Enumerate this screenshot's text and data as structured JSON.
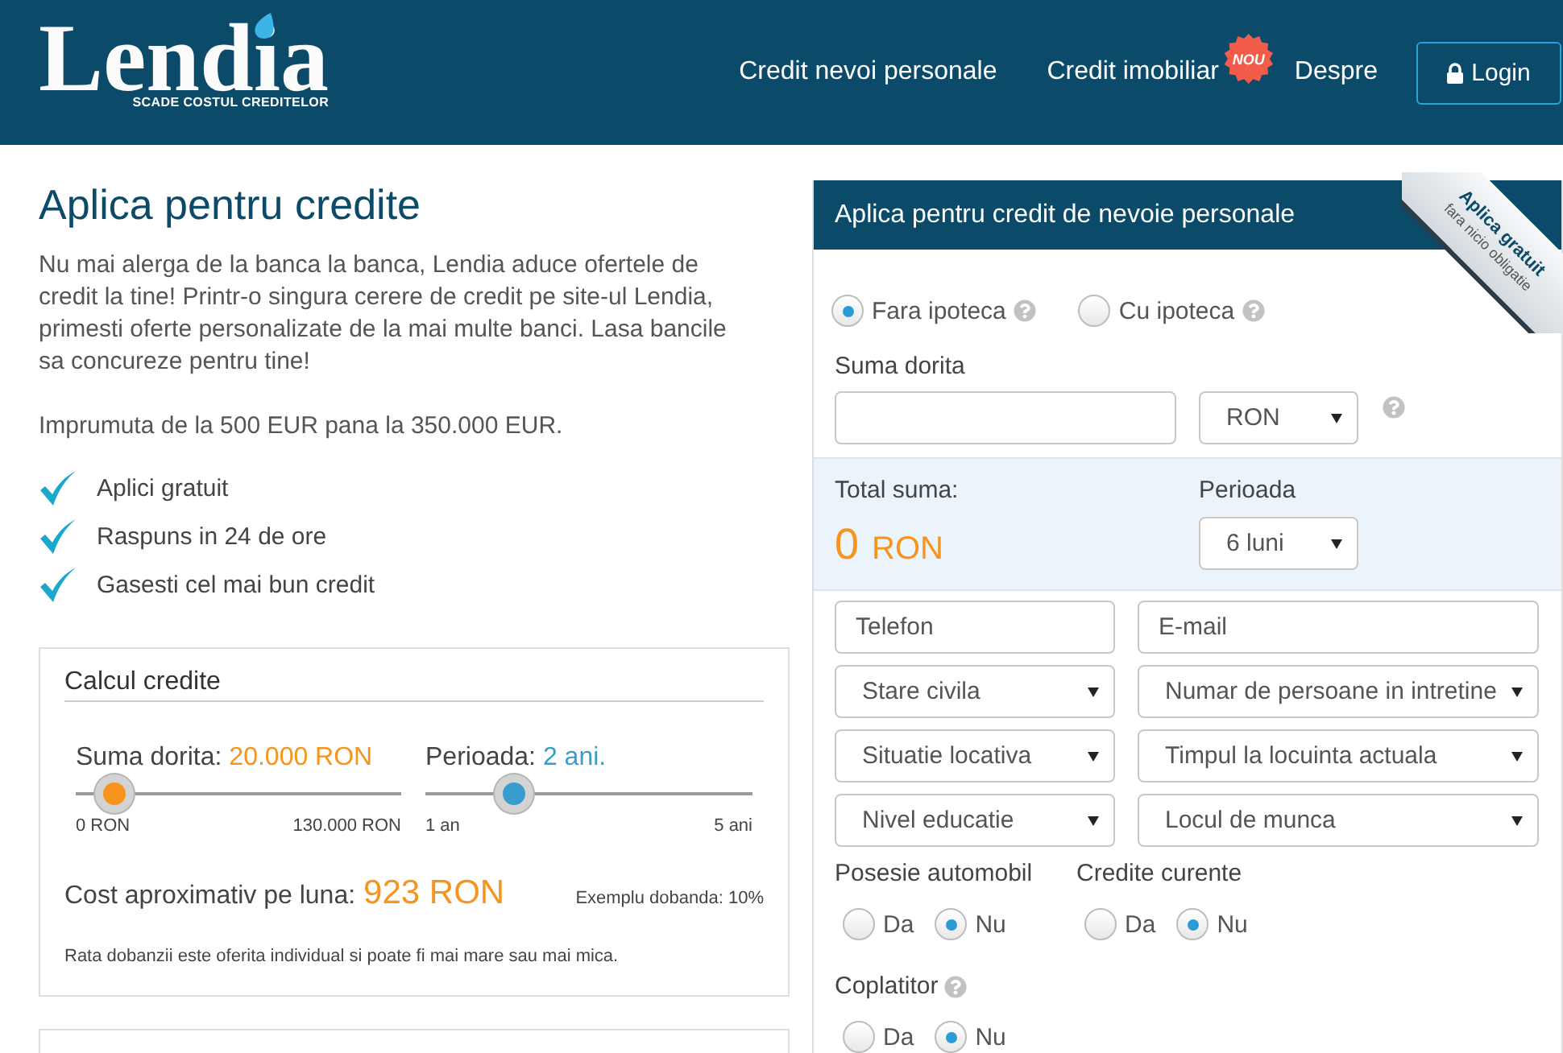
{
  "header": {
    "logo": {
      "wordmark": "Lendia",
      "tagline": "SCADE COSTUL CREDITELOR"
    },
    "nav": [
      {
        "label": "Credit nevoi personale"
      },
      {
        "label": "Credit imobiliar",
        "badge": "NOU"
      },
      {
        "label": "Despre"
      }
    ],
    "login_button": {
      "label": "Login"
    }
  },
  "intro": {
    "title": "Aplica pentru credite",
    "description": "Nu mai alerga de la banca la banca, Lendia aduce ofertele de credit la tine! Printr-o singura cerere de credit pe site-ul Lendia, primesti oferte personalizate de la mai multe banci. Lasa bancile sa concureze pentru tine!",
    "range": "Imprumuta de la 500 EUR pana la 350.000 EUR.",
    "benefits": [
      "Aplici gratuit",
      "Raspuns in 24 de ore",
      "Gasesti cel mai bun credit"
    ]
  },
  "calculator": {
    "title": "Calcul credite",
    "sliders": [
      {
        "label": "Suma dorita:",
        "value": "20.000 RON",
        "color": "#f7941d",
        "level": 0.12,
        "min_label": "0 RON",
        "max_label": "130.000 RON"
      },
      {
        "label": "Perioada:",
        "value": "2 ani.",
        "color": "#3a9ccd",
        "level": 0.27,
        "min_label": "1 an",
        "max_label": "5 ani"
      }
    ],
    "monthly_cost": {
      "label": "Cost aproximativ pe luna:",
      "value": "923 RON"
    },
    "interest_example": "Exemplu dobanda: 10%",
    "note": "Rata dobanzii este oferita individual si poate fi mai mare sau mai mica."
  },
  "application_form": {
    "title": "Aplica pentru credit de nevoie personale",
    "ribbon": {
      "title": "Aplica gratuit",
      "subtitle": "fara nicio obligatie"
    },
    "loan_types": [
      {
        "label": "Fara ipoteca",
        "selected": true
      },
      {
        "label": "Cu ipoteca",
        "selected": false
      }
    ],
    "amount": {
      "label": "Suma dorita",
      "currency": "RON"
    },
    "summary": {
      "total_label": "Total suma:",
      "total_value": "0",
      "total_currency": "RON",
      "period_label": "Perioada",
      "period": "6 luni"
    },
    "fields": [
      {
        "kind": "input",
        "placeholder": "Telefon"
      },
      {
        "kind": "input",
        "placeholder": "E-mail"
      },
      {
        "kind": "select",
        "value": "Stare civila"
      },
      {
        "kind": "select",
        "value": "Numar de persoane in intretine"
      },
      {
        "kind": "select",
        "value": "Situatie locativa"
      },
      {
        "kind": "select",
        "value": "Timpul la locuinta actuala"
      },
      {
        "kind": "select",
        "value": "Nivel educatie"
      },
      {
        "kind": "select",
        "value": "Locul de munca"
      }
    ],
    "radio_groups": [
      {
        "label": "Posesie automobil",
        "help": false,
        "options": [
          {
            "label": "Da",
            "selected": false
          },
          {
            "label": "Nu",
            "selected": true
          }
        ]
      },
      {
        "label": "Credite curente",
        "help": false,
        "options": [
          {
            "label": "Da",
            "selected": false
          },
          {
            "label": "Nu",
            "selected": true
          }
        ]
      },
      {
        "label": "Coplatitor",
        "help": true,
        "options": [
          {
            "label": "Da",
            "selected": false
          },
          {
            "label": "Nu",
            "selected": true
          }
        ]
      }
    ]
  }
}
